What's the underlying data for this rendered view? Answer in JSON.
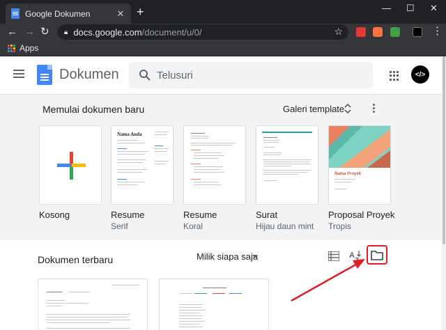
{
  "browser": {
    "tab_title": "Google Dokumen",
    "tab_close": "✕",
    "new_tab": "+",
    "window_controls": {
      "minimize": "—",
      "maximize": "☐",
      "close": "✕"
    },
    "url_host": "docs.google.com",
    "url_path": "/document/u/0/",
    "bookmarks_label": "Apps",
    "extension_colors": [
      "#e53935",
      "#ff7043",
      "#43a047"
    ],
    "apps_colors": [
      "#ea4335",
      "#fbbc05",
      "#34a853",
      "#4285f4",
      "#ea4335",
      "#fbbc05",
      "#34a853",
      "#4285f4",
      "#ea4335"
    ]
  },
  "header": {
    "app_title": "Dokumen",
    "search_placeholder": "Telusuri",
    "avatar_text": "</>"
  },
  "gallery": {
    "title": "Memulai dokumen baru",
    "toggle_label": "Galeri template",
    "templates": [
      {
        "name": "Kosong",
        "sub": ""
      },
      {
        "name": "Resume",
        "sub": "Serif"
      },
      {
        "name": "Resume",
        "sub": "Koral"
      },
      {
        "name": "Surat",
        "sub": "Hijau daun mint"
      },
      {
        "name": "Proposal Proyek",
        "sub": "Tropis"
      }
    ],
    "thumb_text": {
      "resume_serif_heading": "Nama Anda",
      "proposal_heading": "Nama Proyek"
    }
  },
  "recent": {
    "title": "Dokumen terbaru",
    "owner_filter": "Milik siapa saja"
  },
  "colors": {
    "accent_blue": "#4285f4",
    "highlight_red": "#e01b24",
    "gallery_bg": "#f1f3f4"
  }
}
